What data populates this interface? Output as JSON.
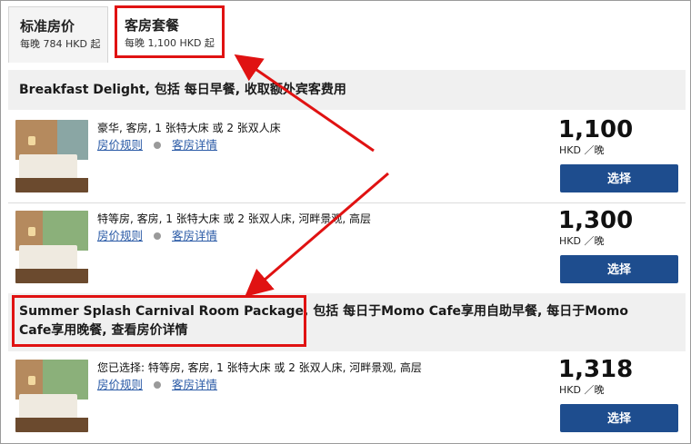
{
  "tabs": [
    {
      "title": "标准房价",
      "subtitle": "每晚 784 HKD 起"
    },
    {
      "title": "客房套餐",
      "subtitle": "每晚 1,100 HKD 起"
    }
  ],
  "packages": [
    {
      "header": "Breakfast Delight, 包括 每日早餐, 收取额外宾客费用",
      "rooms": [
        {
          "description": "豪华, 客房, 1 张特大床 或 2 张双人床",
          "rate_rules": "房价规则",
          "room_details": "客房详情",
          "price": "1,100",
          "unit": "HKD ／晚",
          "select_label": "选择"
        },
        {
          "description": "特等房, 客房, 1 张特大床 或 2 张双人床, 河畔景观, 高层",
          "rate_rules": "房价规则",
          "room_details": "客房详情",
          "price": "1,300",
          "unit": "HKD ／晚",
          "select_label": "选择"
        }
      ]
    },
    {
      "header_line1": "Summer Splash Carnival Room Package, 包括 每日于Momo Cafe享用自助早餐, 每日于Momo",
      "header_line2": "Cafe享用晚餐, 查看房价详情",
      "rooms": [
        {
          "description": "您已选择: 特等房, 客房, 1 张特大床 或 2 张双人床, 河畔景观, 高层",
          "rate_rules": "房价规则",
          "room_details": "客房详情",
          "price": "1,318",
          "unit": "HKD ／晚",
          "select_label": "选择"
        }
      ]
    }
  ],
  "annotation": {
    "color": "#e01212"
  },
  "colors": {
    "button": "#1e4d8e",
    "link": "#2a5aa6",
    "header_bg": "#f0f0f0"
  }
}
